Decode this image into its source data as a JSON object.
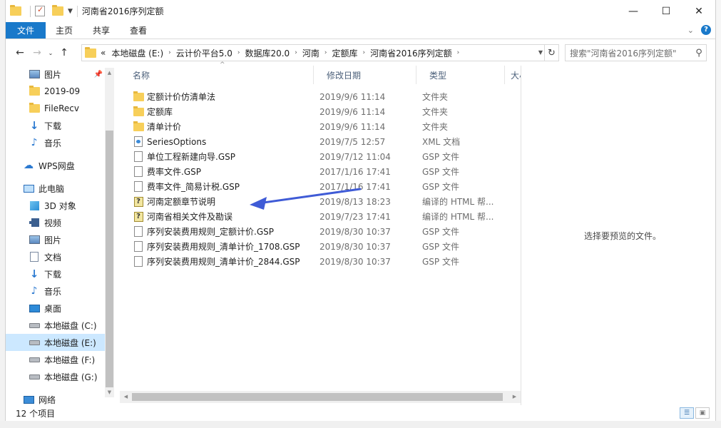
{
  "window": {
    "title": "河南省2016序列定额",
    "controls": {
      "minimize": "—",
      "maximize": "☐",
      "close": "✕"
    }
  },
  "ribbon": {
    "tabs": [
      "文件",
      "主页",
      "共享",
      "查看"
    ],
    "expand_glyph": "⌄",
    "help_glyph": "?"
  },
  "nav": {
    "back": "←",
    "forward": "→",
    "recent": "⌄",
    "up": "↑"
  },
  "address": {
    "prefix": "«",
    "crumbs": [
      "本地磁盘 (E:)",
      "云计价平台5.0",
      "数据库20.0",
      "河南",
      "定额库",
      "河南省2016序列定额"
    ],
    "refresh_glyph": "↻"
  },
  "search": {
    "placeholder": "搜索\"河南省2016序列定额\"",
    "icon": "search-icon"
  },
  "sidebar": {
    "items": [
      {
        "label": "图片",
        "icon": "pictures-icon",
        "pinned": true
      },
      {
        "label": "2019-09",
        "icon": "folder-icon"
      },
      {
        "label": "FileRecv",
        "icon": "folder-icon"
      },
      {
        "label": "下载",
        "icon": "download-icon"
      },
      {
        "label": "音乐",
        "icon": "music-icon"
      },
      {
        "label": "WPS网盘",
        "icon": "cloud-icon"
      },
      {
        "label": "此电脑",
        "icon": "computer-icon"
      },
      {
        "label": "3D 对象",
        "icon": "3d-objects-icon"
      },
      {
        "label": "视频",
        "icon": "video-icon"
      },
      {
        "label": "图片",
        "icon": "pictures-icon"
      },
      {
        "label": "文档",
        "icon": "documents-icon"
      },
      {
        "label": "下载",
        "icon": "download-icon"
      },
      {
        "label": "音乐",
        "icon": "music-icon"
      },
      {
        "label": "桌面",
        "icon": "desktop-icon"
      },
      {
        "label": "本地磁盘 (C:)",
        "icon": "drive-icon"
      },
      {
        "label": "本地磁盘 (E:)",
        "icon": "drive-icon",
        "selected": true
      },
      {
        "label": "本地磁盘 (F:)",
        "icon": "drive-icon"
      },
      {
        "label": "本地磁盘 (G:)",
        "icon": "drive-icon"
      },
      {
        "label": "网络",
        "icon": "network-icon"
      }
    ]
  },
  "columns": {
    "name": "名称",
    "date": "修改日期",
    "type": "类型",
    "size": "大小"
  },
  "files": [
    {
      "name": "定额计价仿清单法",
      "date": "2019/9/6 11:14",
      "type": "文件夹",
      "icon": "folder-icon"
    },
    {
      "name": "定额库",
      "date": "2019/9/6 11:14",
      "type": "文件夹",
      "icon": "folder-icon"
    },
    {
      "name": "清单计价",
      "date": "2019/9/6 11:14",
      "type": "文件夹",
      "icon": "folder-icon"
    },
    {
      "name": "SeriesOptions",
      "date": "2019/7/5 12:57",
      "type": "XML 文档",
      "icon": "xml-file-icon"
    },
    {
      "name": "单位工程新建向导.GSP",
      "date": "2019/7/12 11:04",
      "type": "GSP 文件",
      "icon": "file-icon"
    },
    {
      "name": "费率文件.GSP",
      "date": "2017/1/16 17:41",
      "type": "GSP 文件",
      "icon": "file-icon"
    },
    {
      "name": "费率文件_简易计税.GSP",
      "date": "2017/1/16 17:41",
      "type": "GSP 文件",
      "icon": "file-icon"
    },
    {
      "name": "河南定额章节说明",
      "date": "2019/8/13 18:23",
      "type": "编译的 HTML 帮...",
      "icon": "chm-help-icon"
    },
    {
      "name": "河南省相关文件及勘误",
      "date": "2019/7/23 17:41",
      "type": "编译的 HTML 帮...",
      "icon": "chm-help-icon"
    },
    {
      "name": "序列安装费用规则_定额计价.GSP",
      "date": "2019/8/30 10:37",
      "type": "GSP 文件",
      "icon": "file-icon"
    },
    {
      "name": "序列安装费用规则_清单计价_1708.GSP",
      "date": "2019/8/30 10:37",
      "type": "GSP 文件",
      "icon": "file-icon"
    },
    {
      "name": "序列安装费用规则_清单计价_2844.GSP",
      "date": "2019/8/30 10:37",
      "type": "GSP 文件",
      "icon": "file-icon"
    }
  ],
  "preview": {
    "message": "选择要预览的文件。"
  },
  "status": {
    "item_count": "12 个项目"
  },
  "colors": {
    "accent": "#1979ca",
    "selection": "#cce8ff",
    "arrow": "#3f5bd6"
  }
}
